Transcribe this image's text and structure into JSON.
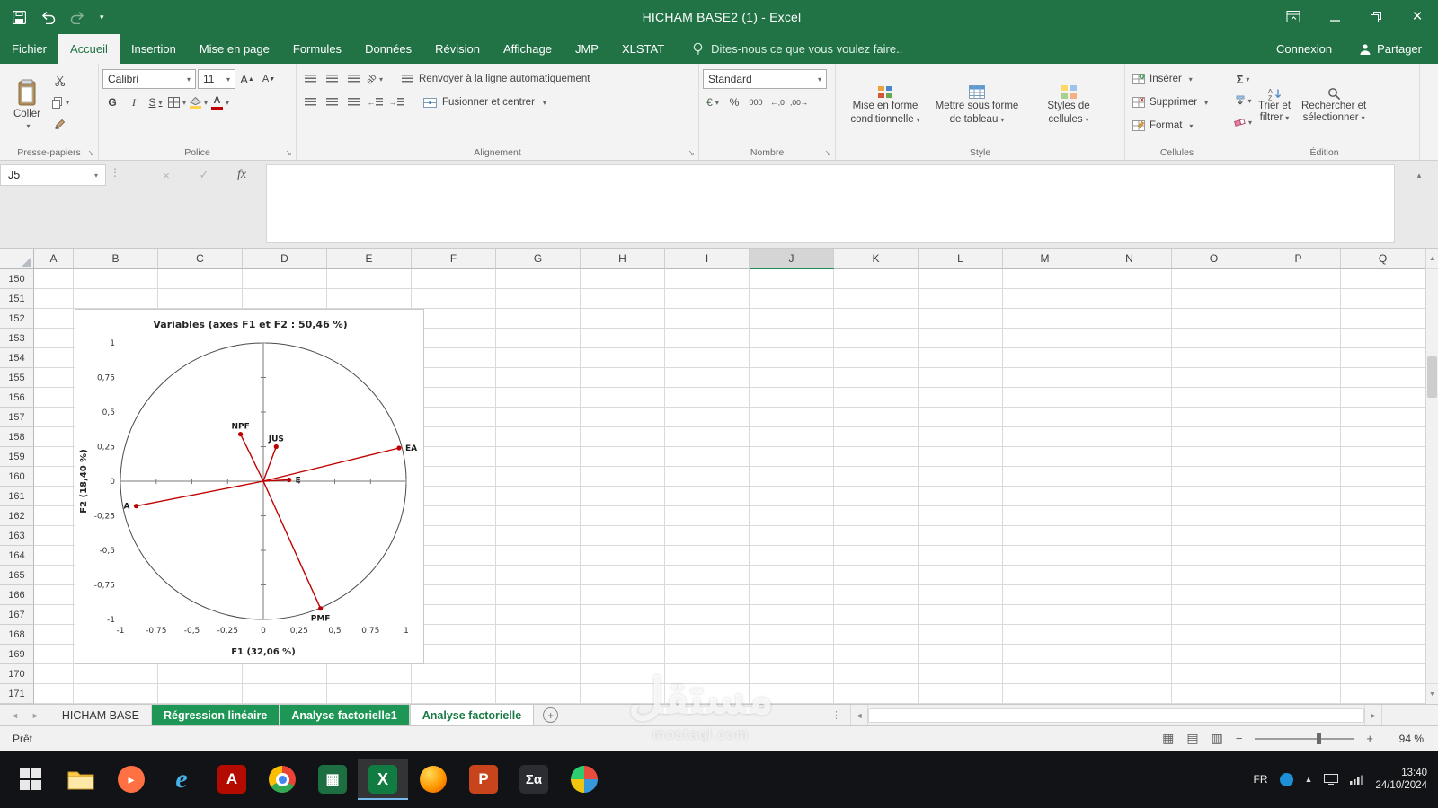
{
  "window": {
    "title": "HICHAM BASE2 (1) - Excel"
  },
  "menu": {
    "tabs": [
      {
        "label": "Fichier",
        "active": false
      },
      {
        "label": "Accueil",
        "active": true
      },
      {
        "label": "Insertion",
        "active": false
      },
      {
        "label": "Mise en page",
        "active": false
      },
      {
        "label": "Formules",
        "active": false
      },
      {
        "label": "Données",
        "active": false
      },
      {
        "label": "Révision",
        "active": false
      },
      {
        "label": "Affichage",
        "active": false
      },
      {
        "label": "JMP",
        "active": false
      },
      {
        "label": "XLSTAT",
        "active": false
      }
    ],
    "search_text": "Dites-nous ce que vous voulez faire..",
    "connexion_label": "Connexion",
    "partager_label": "Partager"
  },
  "ribbon": {
    "clipboard": {
      "paste_label": "Coller",
      "group_label": "Presse-papiers"
    },
    "font": {
      "font_name": "Calibri",
      "font_size": "11",
      "bold_glyph": "G",
      "italic_glyph": "I",
      "underline_glyph": "S",
      "grow_glyph": "A",
      "shrink_glyph": "A",
      "group_label": "Police"
    },
    "alignment": {
      "wrap_label": "Renvoyer à la ligne automatiquement",
      "merge_label": "Fusionner et centrer",
      "group_label": "Alignement"
    },
    "number": {
      "format_value": "Standard",
      "accounting_glyph": "€",
      "percent_glyph": "%",
      "thousands_glyph": "000",
      "inc_decimal_glyph": "←,0",
      "dec_decimal_glyph": ",00→",
      "group_label": "Nombre"
    },
    "style": {
      "conditional_line1": "Mise en forme",
      "conditional_line2": "conditionnelle",
      "table_line1": "Mettre sous forme",
      "table_line2": "de tableau",
      "cellstyles_line1": "Styles de",
      "cellstyles_line2": "cellules",
      "group_label": "Style"
    },
    "cells": {
      "insert_label": "Insérer",
      "delete_label": "Supprimer",
      "format_label": "Format",
      "group_label": "Cellules"
    },
    "editing": {
      "sum_glyph": "Σ",
      "sort_line1": "Trier et",
      "sort_line2": "filtrer",
      "find_line1": "Rechercher et",
      "find_line2": "sélectionner",
      "group_label": "Édition"
    }
  },
  "formula_bar": {
    "name_box": "J5",
    "cancel_glyph": "×",
    "enter_glyph": "✓",
    "fx_label": "fx",
    "content": ""
  },
  "grid": {
    "columns": [
      "A",
      "B",
      "C",
      "D",
      "E",
      "F",
      "G",
      "H",
      "I",
      "J",
      "K",
      "L",
      "M",
      "N",
      "O",
      "P",
      "Q"
    ],
    "active_column": "J",
    "rows": [
      "150",
      "151",
      "152",
      "153",
      "154",
      "155",
      "156",
      "157",
      "158",
      "159",
      "160",
      "161",
      "162",
      "163",
      "164",
      "165",
      "166",
      "167",
      "168",
      "169",
      "170",
      "171"
    ]
  },
  "chart_data": {
    "type": "scatter",
    "title": "Variables (axes F1 et F2 : 50,46 %)",
    "xlabel": "F1 (32,06 %)",
    "ylabel": "F2 (18,40 %)",
    "xlim": [
      -1,
      1
    ],
    "ylim": [
      -1,
      1
    ],
    "ticks": [
      -1,
      -0.75,
      -0.5,
      -0.25,
      0,
      0.25,
      0.5,
      0.75,
      1
    ],
    "tick_labels": [
      "-1",
      "-0,75",
      "-0,5",
      "-0,25",
      "0",
      "0,25",
      "0,5",
      "0,75",
      "1"
    ],
    "unit_circle": true,
    "grid": false,
    "vector_color": "#c00000",
    "points": [
      {
        "label": "NPF",
        "x": -0.16,
        "y": 0.34,
        "label_pos": "above"
      },
      {
        "label": "JUS",
        "x": 0.09,
        "y": 0.25,
        "label_pos": "above"
      },
      {
        "label": "EA",
        "x": 0.95,
        "y": 0.24,
        "label_pos": "right"
      },
      {
        "label": "E",
        "x": 0.18,
        "y": 0.01,
        "label_pos": "right"
      },
      {
        "label": "PMF",
        "x": 0.4,
        "y": -0.92,
        "label_pos": "below"
      },
      {
        "label": "A",
        "x": -0.89,
        "y": -0.18,
        "label_pos": "left"
      }
    ]
  },
  "sheet_tabs": {
    "items": [
      {
        "label": "HICHAM BASE",
        "variant": "plain"
      },
      {
        "label": "Régression linéaire",
        "variant": "green"
      },
      {
        "label": "Analyse factorielle1",
        "variant": "green"
      },
      {
        "label": "Analyse factorielle",
        "variant": "active"
      }
    ]
  },
  "status_bar": {
    "mode": "Prêt",
    "zoom": "94 %"
  },
  "taskbar": {
    "lang": "FR",
    "time": "13:40",
    "date": "24/10/2024"
  },
  "watermark": {
    "main": "مستقل",
    "sub": "mostaql.com"
  }
}
